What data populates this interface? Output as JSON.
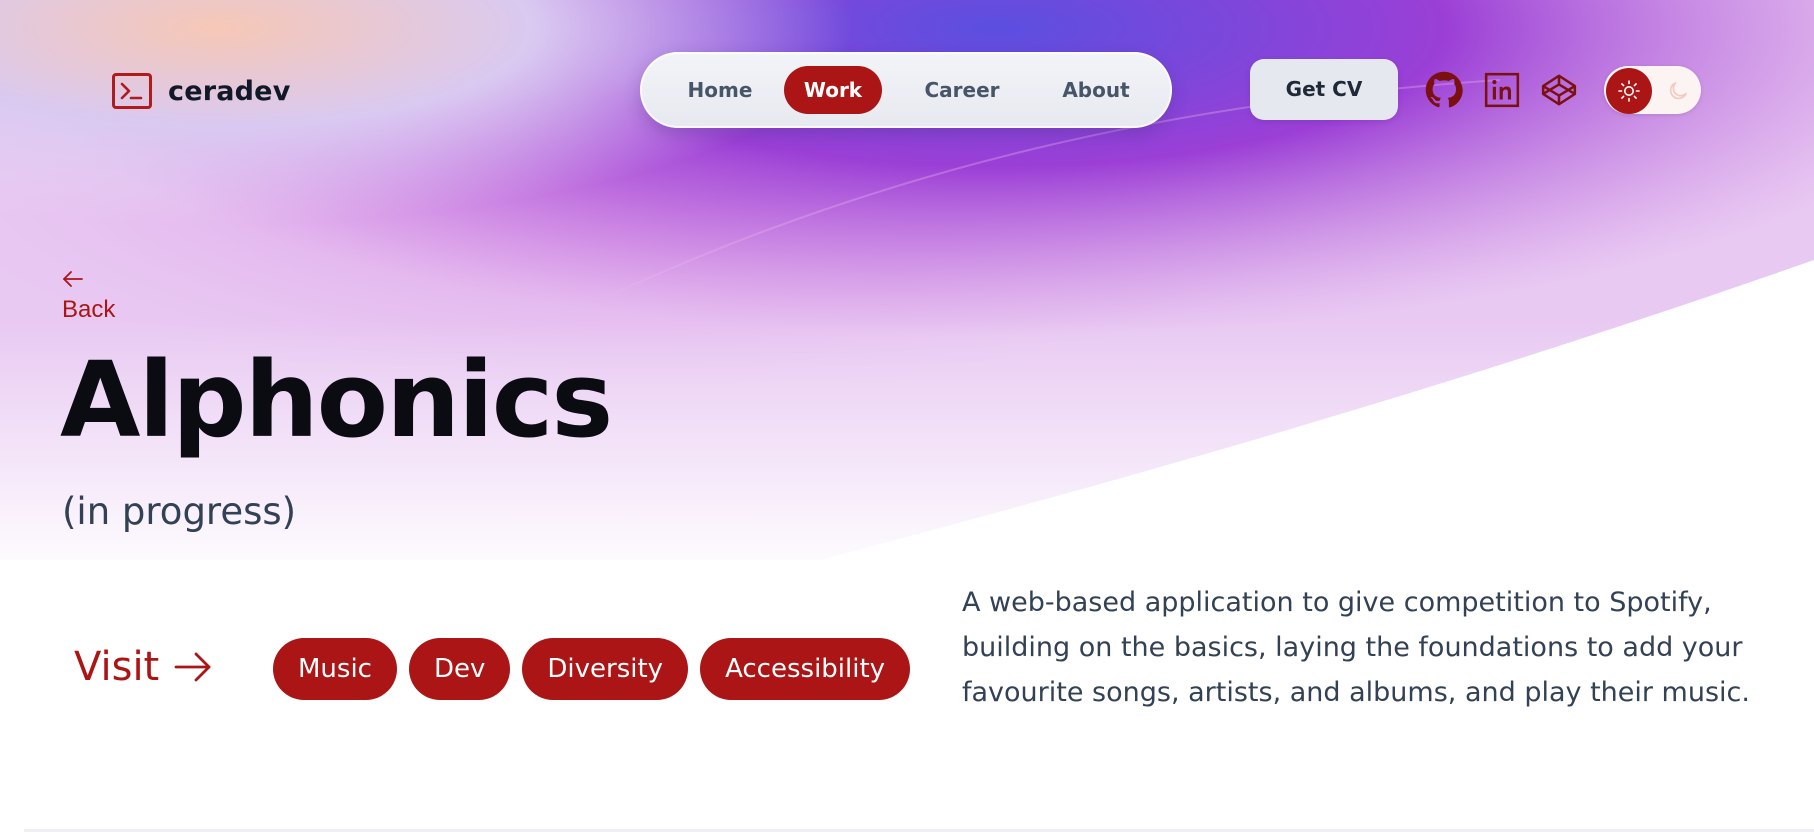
{
  "brand": {
    "name": "ceradev",
    "accent": "#ab1515"
  },
  "nav": {
    "items": [
      {
        "label": "Home",
        "active": false
      },
      {
        "label": "Work",
        "active": true
      },
      {
        "label": "Career",
        "active": false
      },
      {
        "label": "About",
        "active": false
      }
    ]
  },
  "header": {
    "cv_label": "Get CV",
    "social_icons": [
      "github-icon",
      "linkedin-icon",
      "codepen-icon"
    ],
    "theme_toggle": {
      "selected": "light",
      "icons": [
        "sun-icon",
        "moon-icon"
      ]
    }
  },
  "project": {
    "back_label": "Back",
    "title": "Alphonics",
    "status": "(in progress)",
    "visit_label": "Visit",
    "tags": [
      "Music",
      "Dev",
      "Diversity",
      "Accessibility"
    ],
    "description": "A web-based application to give competition to Spotify, building on the basics, laying the foundations to add your favourite songs, artists, and albums, and play their music."
  }
}
